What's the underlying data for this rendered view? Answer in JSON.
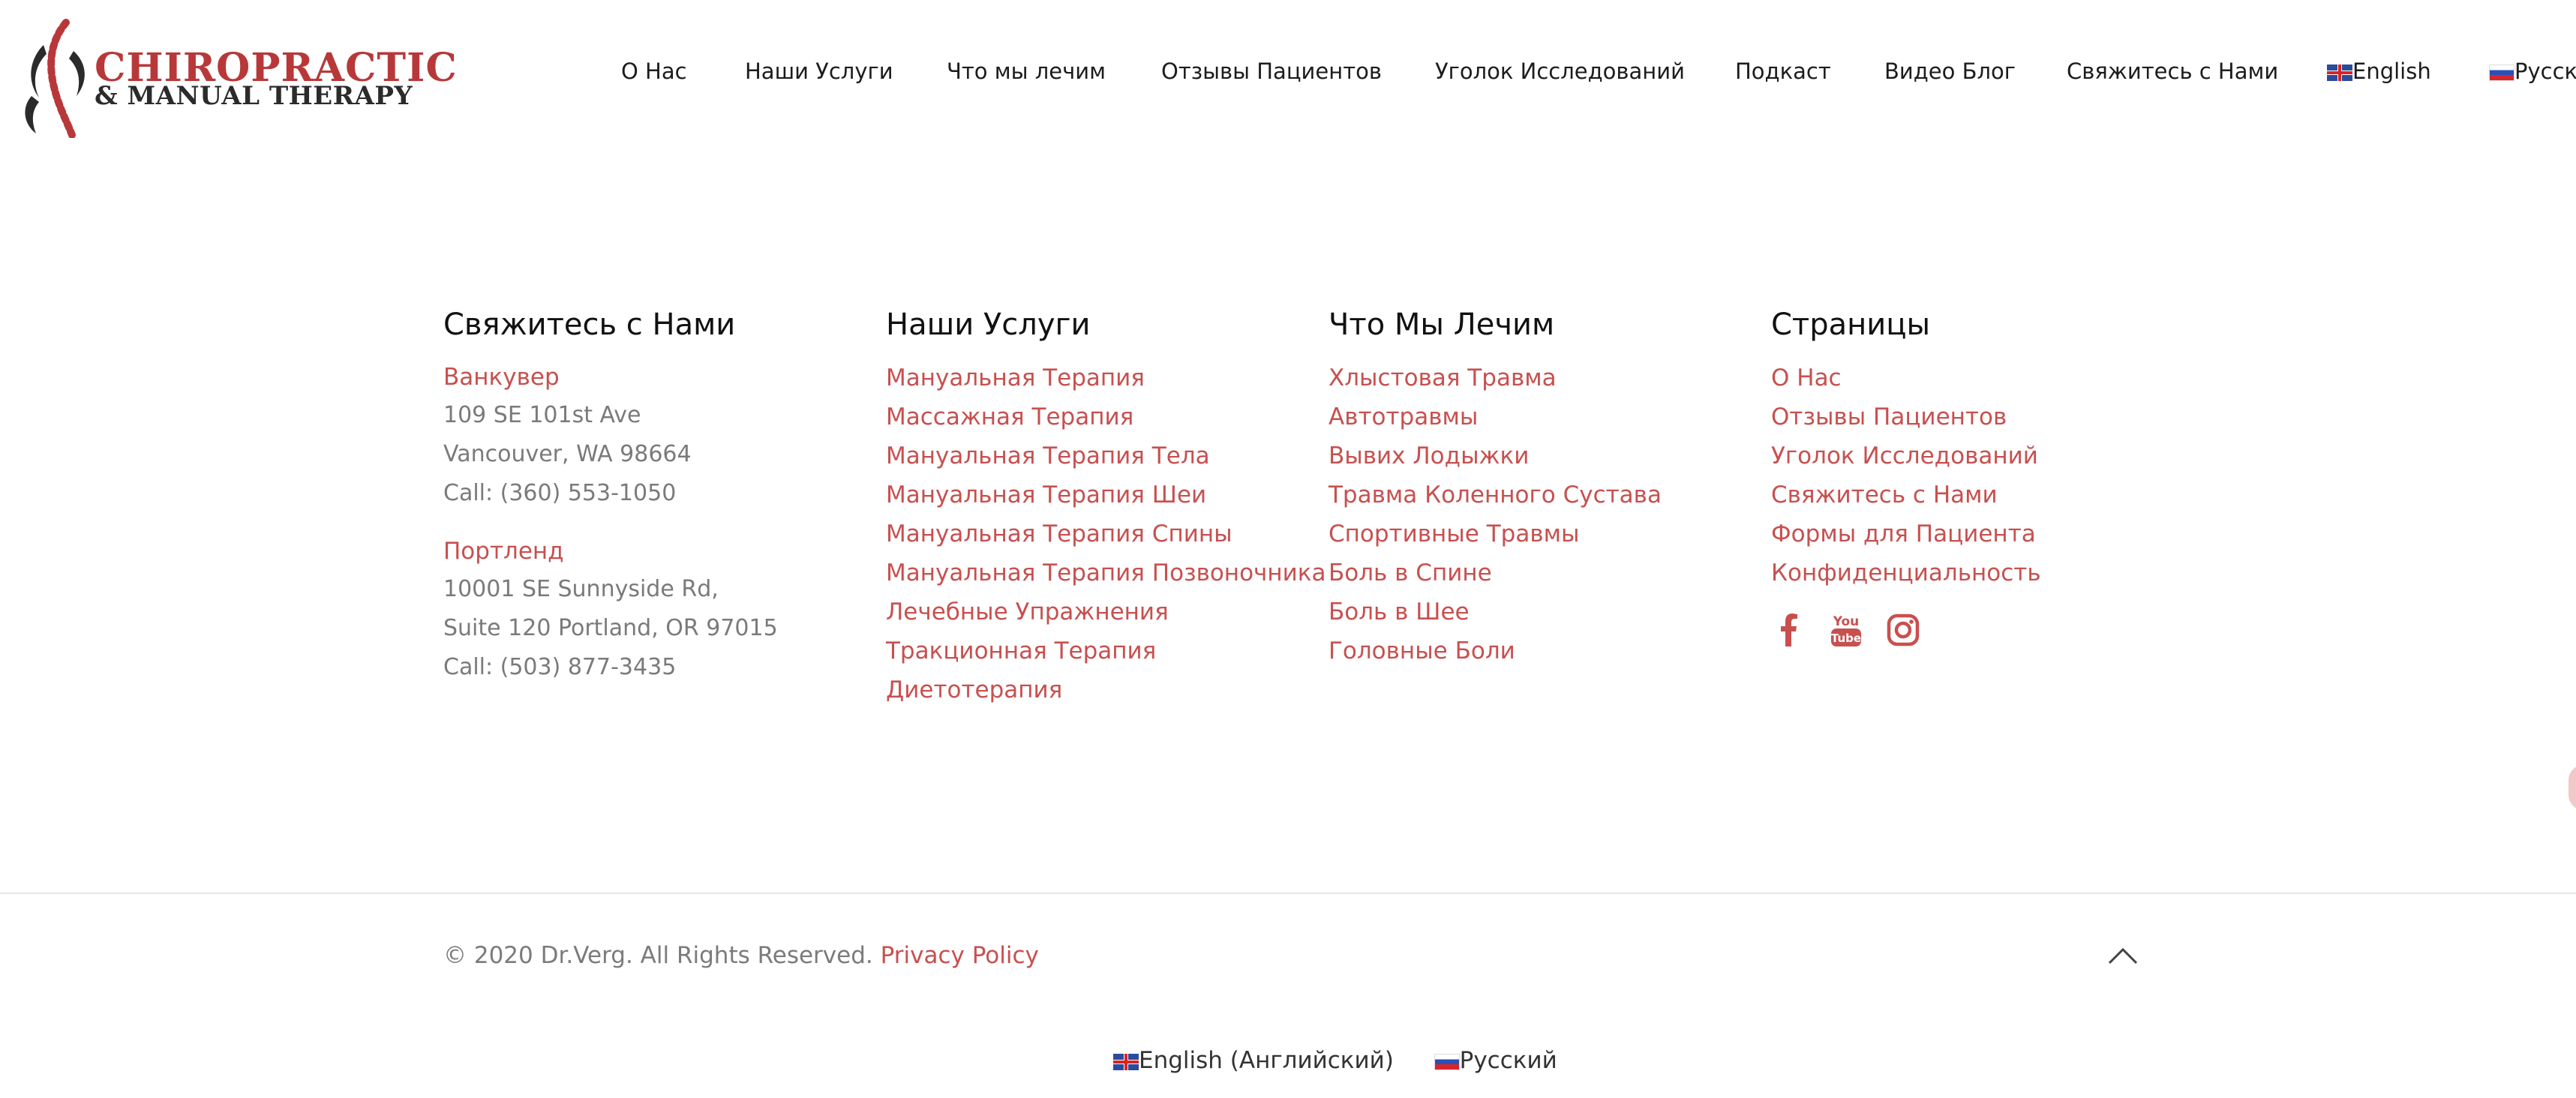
{
  "logo": {
    "line1": "CHIROPRACTIC",
    "line2": "& MANUAL THERAPY"
  },
  "nav": {
    "items": [
      "О Нас",
      "Наши Услуги",
      "Что мы лечим",
      "Отзывы Пациентов",
      "Уголок Исследований",
      "Подкаст",
      "Видео Блог",
      "Свяжитесь с Нами"
    ],
    "lang_en": "English",
    "lang_ru": "Русск"
  },
  "contact": {
    "title": "Свяжитесь с Нами",
    "vancouver": {
      "city": "Ванкувер",
      "line1": "109 SE 101st Ave",
      "line2": "Vancouver, WA 98664",
      "phone": "Call: (360) 553-1050"
    },
    "portland": {
      "city": "Портленд",
      "line1": "10001 SE Sunnyside Rd,",
      "line2": "Suite 120 Portland, OR 97015",
      "phone": "Call: (503) 877-3435"
    }
  },
  "services": {
    "title": "Наши Услуги",
    "links": [
      "Мануальная Терапия",
      "Массажная Терапия",
      "Мануальная Терапия Тела",
      "Мануальная Терапия Шеи",
      "Мануальная Терапия Спины",
      "Мануальная Терапия Позвоночника",
      "Лечебные Упражнения",
      "Тракционная Терапия",
      "Диетотерапия"
    ]
  },
  "treat": {
    "title": "Что Мы Лечим",
    "links": [
      "Хлыстовая Травма",
      "Автотравмы",
      "Вывих Лодыжки",
      "Травма Коленного Сустава",
      "Спортивные Травмы",
      "Боль в Спине",
      "Боль в Шее",
      "Головные Боли"
    ]
  },
  "pages": {
    "title": "Страницы",
    "links": [
      "О Нас",
      "Отзывы Пациентов",
      "Уголок Исследований",
      "Свяжитесь с Нами",
      "Формы для Пациента",
      "Конфиденциальность"
    ],
    "social_icons": [
      "facebook-icon",
      "youtube-icon",
      "instagram-icon"
    ]
  },
  "footer": {
    "copyright": "© 2020 Dr.Verg. All Rights Reserved.",
    "privacy": "Privacy Policy",
    "lang_en": "English (Английский)",
    "lang_ru": "Русский"
  },
  "colors": {
    "accent": "#c7504f",
    "logo_red": "#b8383a",
    "text_gray": "#7a7a7a"
  }
}
